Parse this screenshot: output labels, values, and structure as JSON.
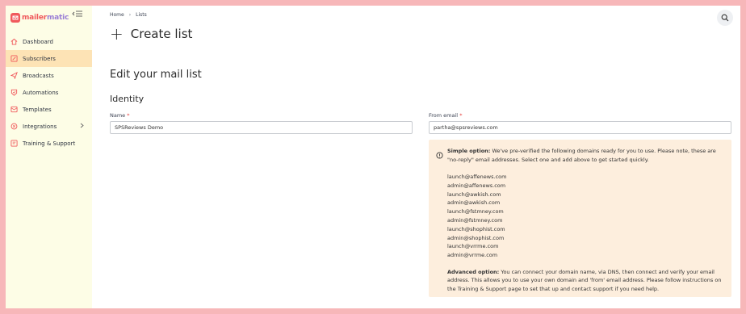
{
  "brand": {
    "logo_part1": "mailer",
    "logo_part2": "matic"
  },
  "sidebar": {
    "items": [
      {
        "label": "Dashboard",
        "icon": "home-icon",
        "active": false
      },
      {
        "label": "Subscribers",
        "icon": "subscribers-icon",
        "active": true
      },
      {
        "label": "Broadcasts",
        "icon": "send-icon",
        "active": false
      },
      {
        "label": "Automations",
        "icon": "automation-icon",
        "active": false
      },
      {
        "label": "Templates",
        "icon": "template-icon",
        "active": false
      },
      {
        "label": "Integrations",
        "icon": "integrations-icon",
        "active": false
      },
      {
        "label": "Training & Support",
        "icon": "training-icon",
        "active": false
      }
    ]
  },
  "breadcrumb": {
    "home": "Home",
    "current": "Lists",
    "separator": "›"
  },
  "page": {
    "title": "Create list",
    "section": "Edit your mail list",
    "subsection": "Identity"
  },
  "form": {
    "name_label": "Name",
    "name_value": "SPSReviews Demo",
    "from_label": "From email",
    "from_value": "partha@spsreviews.com",
    "required_mark": "*"
  },
  "info": {
    "simple_title": "Simple option:",
    "simple_text": " We've pre-verified the following domains ready for you to use. Please note, these are \"no-reply\" email addresses. Select one and add above to get started quickly.",
    "emails": [
      "launch@affenews.com",
      "admin@affenews.com",
      "launch@awkish.com",
      "admin@awkish.com",
      "launch@fstmney.com",
      "admin@fstmney.com",
      "launch@shophist.com",
      "admin@shophist.com",
      "launch@vrrme.com",
      "admin@vrrme.com"
    ],
    "advanced_title": "Advanced option:",
    "advanced_text": " You can connect your domain name, via DNS, then connect and verify your email address. This allows you to use your own domain and 'from' email address. Please follow instructions on the Training & Support page to set that up and contact support if you need help."
  },
  "colors": {
    "accent": "#f0595c",
    "sidebar_bg": "#fdfde6",
    "active_bg": "#fde3b5",
    "info_bg": "#fdeedd",
    "outer_bg": "#f7b7b9"
  }
}
